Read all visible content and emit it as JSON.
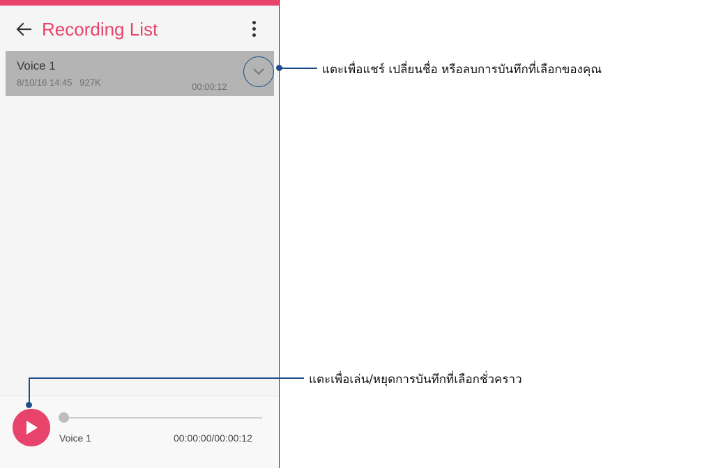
{
  "app": {
    "title": "Recording List"
  },
  "recording_list": {
    "items": [
      {
        "name": "Voice 1",
        "meta": "8/10/16 14:45   927K",
        "duration": "00:00:12"
      }
    ]
  },
  "player": {
    "track_name": "Voice 1",
    "time": "00:00:00/00:00:12",
    "progress": 0
  },
  "callouts": {
    "expand_options": "แตะเพื่อแชร์ เปลี่ยนชื่อ หรือลบการบันทึกที่เลือกของคุณ",
    "play_pause": "แตะเพื่อเล่น/หยุดการบันทึกที่เลือกชั่วคราว"
  },
  "icons": {
    "back": "arrow-back-icon",
    "overflow": "more-vert-icon",
    "expand": "chevron-down-icon",
    "play": "play-icon"
  },
  "colors": {
    "accent": "#e8436b",
    "callout": "#1e4d8c",
    "selected_row": "#b4b4b4"
  }
}
